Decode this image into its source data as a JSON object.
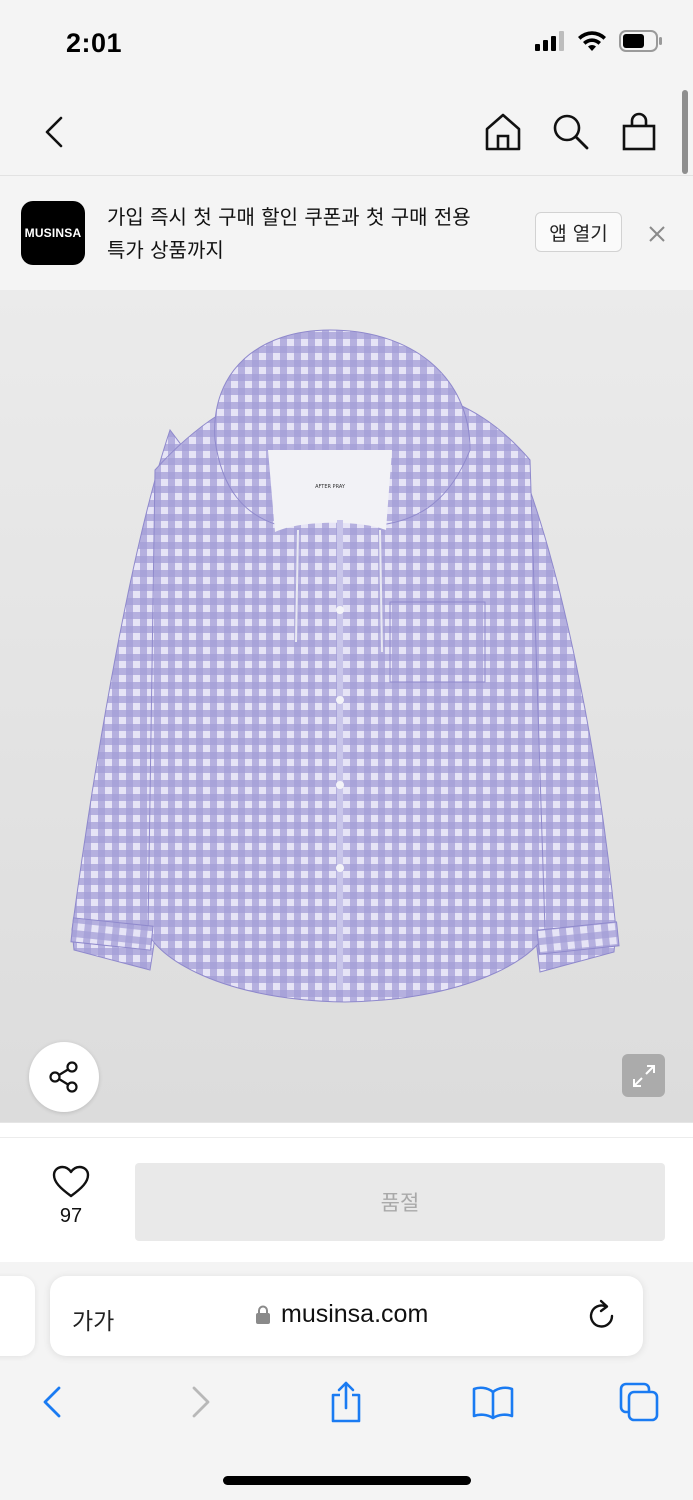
{
  "status_bar": {
    "time": "2:01",
    "icons": [
      "cellular-signal-icon",
      "wifi-icon",
      "battery-icon"
    ]
  },
  "nav": {
    "icons": [
      "back-icon",
      "home-icon",
      "search-icon",
      "shopping-bag-icon"
    ]
  },
  "app_banner": {
    "logo_text": "MUSINSA",
    "line1": "가입 즉시 첫 구매 할인 쿠폰과 첫 구매 전용",
    "line2": "특가 상품까지",
    "open_button": "앱 열기",
    "close_icon": "close-icon"
  },
  "product": {
    "image_subject": "lavender gingham hooded shirt",
    "label_text": "AFTER PRAY",
    "share_icon": "share-icon",
    "expand_icon": "expand-icon"
  },
  "purchase": {
    "like_count": "97",
    "soldout_label": "품절",
    "heart_icon": "heart-icon"
  },
  "browser": {
    "text_size_label": "가가",
    "url": "musinsa.com",
    "toolbar_icons": [
      "back-arrow-icon",
      "forward-arrow-icon",
      "share-sheet-icon",
      "bookmarks-icon",
      "tabs-icon"
    ]
  },
  "colors": {
    "accent_blue": "#1a7bf2",
    "banner_bg": "#f4f4f4",
    "soldout_bg": "#e9e9e9",
    "shirt": "#8f89cc"
  }
}
